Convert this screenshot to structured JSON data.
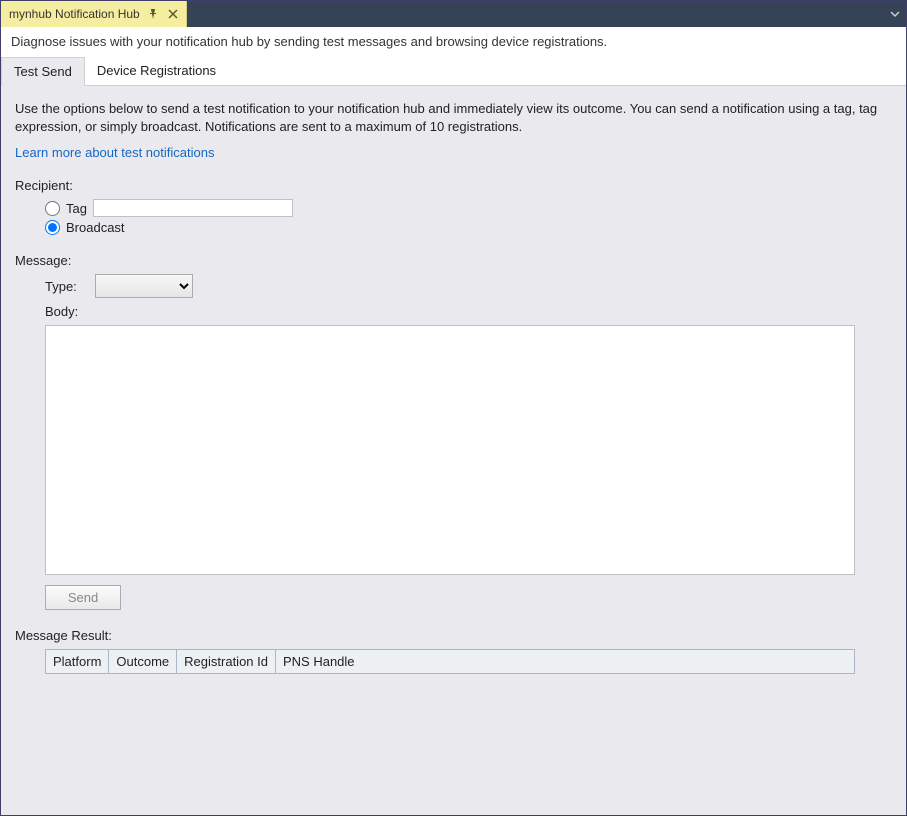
{
  "window": {
    "tab_title": "mynhub Notification Hub"
  },
  "subheader": "Diagnose issues with your notification hub by sending test messages and browsing device registrations.",
  "tabs": {
    "test_send": "Test Send",
    "device_registrations": "Device Registrations"
  },
  "intro": "Use the options below to send a test notification to your notification hub and immediately view its outcome. You can send a notification using a tag, tag expression, or simply broadcast. Notifications are sent to a maximum of 10 registrations.",
  "learn_more": "Learn more about test notifications",
  "recipient": {
    "label": "Recipient:",
    "tag_label": "Tag",
    "tag_value": "",
    "broadcast_label": "Broadcast"
  },
  "message": {
    "label": "Message:",
    "type_label": "Type:",
    "type_value": "",
    "body_label": "Body:",
    "body_value": ""
  },
  "send_button": "Send",
  "result": {
    "label": "Message Result:",
    "columns": {
      "platform": "Platform",
      "outcome": "Outcome",
      "registration_id": "Registration Id",
      "pns_handle": "PNS Handle"
    }
  }
}
